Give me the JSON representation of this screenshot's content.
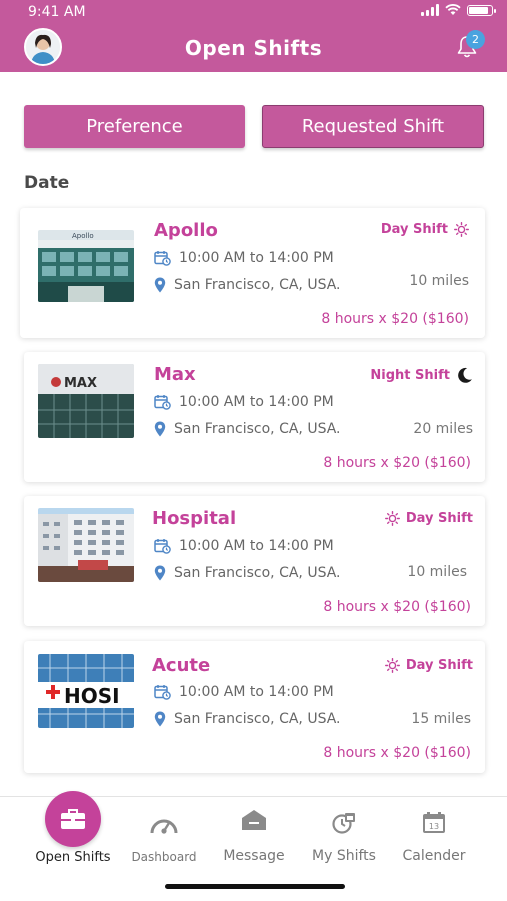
{
  "status": {
    "time": "9:41 AM"
  },
  "header": {
    "title": "Open Shifts",
    "notification_count": "2"
  },
  "actions": {
    "preference": "Preference",
    "requested": "Requested Shift"
  },
  "section": {
    "date_label": "Date"
  },
  "shifts": [
    {
      "name": "Apollo",
      "shift": "Day Shift",
      "shift_icon": "sun-icon",
      "time": "10:00 AM to 14:00 PM",
      "location": "San Francisco, CA, USA.",
      "distance": "10 miles",
      "pay": "8 hours x $20 ($160)",
      "thumb_text": "Apollo"
    },
    {
      "name": "Max",
      "shift": "Night Shift",
      "shift_icon": "moon-icon",
      "time": "10:00 AM to 14:00 PM",
      "location": "San Francisco, CA, USA.",
      "distance": "20 miles",
      "pay": "8 hours x $20 ($160)",
      "thumb_text": "MAX"
    },
    {
      "name": "Hospital",
      "shift": "Day Shift",
      "shift_icon": "sun-icon",
      "time": "10:00 AM to 14:00 PM",
      "location": "San Francisco, CA, USA.",
      "distance": "10 miles",
      "pay": "8 hours x $20 ($160)",
      "thumb_text": ""
    },
    {
      "name": "Acute",
      "shift": "Day Shift",
      "shift_icon": "sun-icon",
      "time": "10:00 AM to 14:00 PM",
      "location": "San Francisco, CA, USA.",
      "distance": "15 miles",
      "pay": "8 hours x $20 ($160)",
      "thumb_text": "HOSI"
    }
  ],
  "nav": {
    "items": [
      {
        "label": "Open Shifts",
        "icon": "briefcase-icon",
        "active": true
      },
      {
        "label": "Dashboard",
        "icon": "speedometer-icon",
        "active": false
      },
      {
        "label": "Message",
        "icon": "envelope-icon",
        "active": false
      },
      {
        "label": "My Shifts",
        "icon": "calendar-clock-icon",
        "active": false
      },
      {
        "label": "Calender",
        "icon": "calendar-icon",
        "active": false
      }
    ],
    "calendar_day": "13"
  },
  "colors": {
    "brand": "#c4599c",
    "accent": "#c4429a",
    "badge": "#4aa3df"
  }
}
